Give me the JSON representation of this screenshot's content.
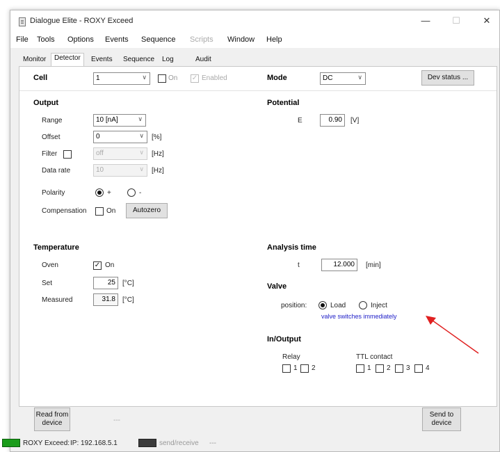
{
  "window": {
    "title": "Dialogue Elite - ROXY Exceed",
    "buttons": {
      "minimize": "—",
      "maximize": "☐",
      "close": "✕"
    }
  },
  "menu": [
    "File",
    "Tools",
    "Options",
    "Events",
    "Sequence",
    "Scripts",
    "Window",
    "Help"
  ],
  "menu_disabled": [
    "Scripts"
  ],
  "tabs": [
    "Monitor",
    "Detector",
    "Events",
    "Sequence",
    "Log",
    "Audit"
  ],
  "active_tab": "Detector",
  "cell": {
    "label": "Cell",
    "value": "1",
    "on_label": "On",
    "enabled_label": "Enabled"
  },
  "mode": {
    "label": "Mode",
    "value": "DC",
    "dev_status": "Dev status ..."
  },
  "output": {
    "title": "Output",
    "range_label": "Range",
    "range_value": "10 [nA]",
    "offset_label": "Offset",
    "offset_value": "0",
    "offset_unit": "[%]",
    "filter_label": "Filter",
    "filter_value": "off",
    "filter_unit": "[Hz]",
    "datarate_label": "Data rate",
    "datarate_value": "10",
    "datarate_unit": "[Hz]",
    "polarity_label": "Polarity",
    "polarity_plus": "+",
    "polarity_minus": "-",
    "compensation_label": "Compensation",
    "compensation_on": "On",
    "autozero": "Autozero"
  },
  "potential": {
    "title": "Potential",
    "e_label": "E",
    "e_value": "0.90",
    "e_unit": "[V]"
  },
  "temperature": {
    "title": "Temperature",
    "oven_label": "Oven",
    "oven_on": "On",
    "set_label": "Set",
    "set_value": "25",
    "set_unit": "[°C]",
    "measured_label": "Measured",
    "measured_value": "31.8",
    "measured_unit": "[°C]"
  },
  "analysis": {
    "title": "Analysis time",
    "t_label": "t",
    "t_value": "12.000",
    "t_unit": "[min]"
  },
  "valve": {
    "title": "Valve",
    "position_label": "position:",
    "load": "Load",
    "inject": "Inject",
    "note": "valve switches immediately"
  },
  "inout": {
    "title": "In/Output",
    "relay_label": "Relay",
    "relay_1": "1",
    "relay_2": "2",
    "ttl_label": "TTL contact",
    "ttl_1": "1",
    "ttl_2": "2",
    "ttl_3": "3",
    "ttl_4": "4"
  },
  "buttons": {
    "read_from_device": "Read from device",
    "dash": "---",
    "send_to_device": "Send to device"
  },
  "status": {
    "device": "ROXY Exceed:",
    "ip": "IP: 192.168.5.1",
    "sendreceive": "send/receive",
    "trail": "---"
  },
  "colors": {
    "led_green": "#1a9c1a",
    "led_dark": "#3b3b3b",
    "arrow": "#e02020",
    "note_blue": "#2020c8"
  }
}
